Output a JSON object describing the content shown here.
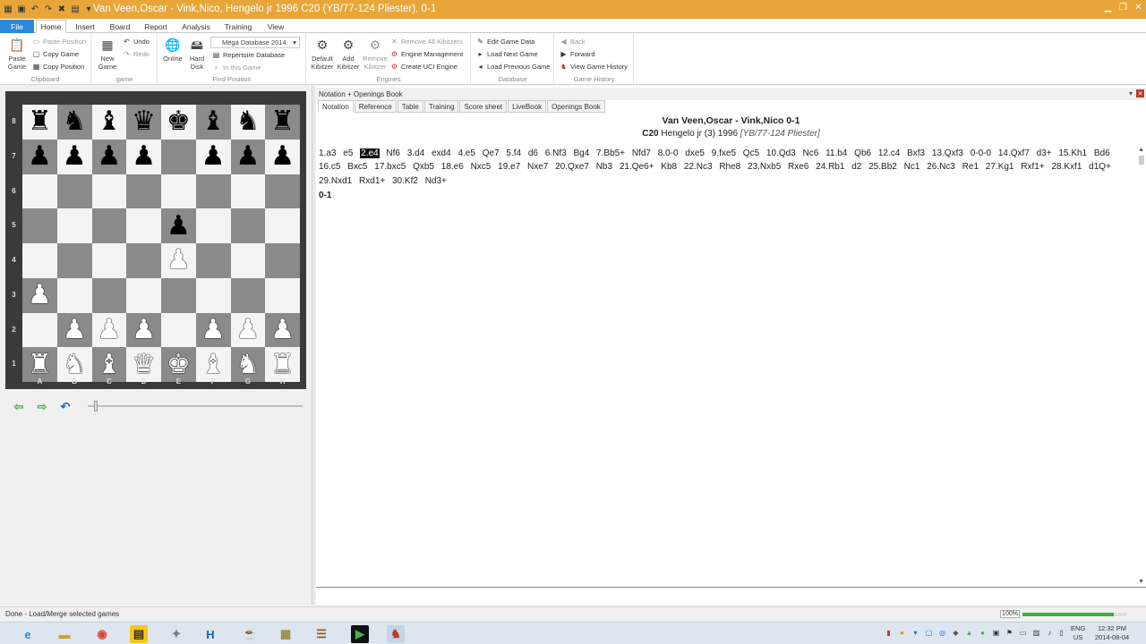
{
  "window": {
    "title": "Van Veen,Oscar - Vink,Nico, Hengelo jr 1996  C20  (YB/77-124 Pliester), 0-1"
  },
  "ribbon_tabs": [
    {
      "label": "File"
    },
    {
      "label": "Home"
    },
    {
      "label": "Insert"
    },
    {
      "label": "Board"
    },
    {
      "label": "Report"
    },
    {
      "label": "Analysis"
    },
    {
      "label": "Training"
    },
    {
      "label": "View"
    }
  ],
  "ribbon": {
    "clipboard": {
      "group": "Clipboard",
      "paste_game_1": "Paste",
      "paste_game_2": "Game",
      "paste_position": "Paste Position",
      "copy_game": "Copy Game",
      "copy_position": "Copy Position"
    },
    "game": {
      "group": "game",
      "new_game_1": "New",
      "new_game_2": "Game",
      "undo": "Undo",
      "redo": "Redo"
    },
    "find_position": {
      "group": "Find Position",
      "online": "Online",
      "hard_disk_1": "Hard",
      "hard_disk_2": "Disk",
      "database_select": "Mega Database 2014",
      "repertoire": "Repertoire Database",
      "in_this_game": "In this Game"
    },
    "engines": {
      "group": "Engines",
      "default_kibitzer_1": "Default",
      "default_kibitzer_2": "Kibitzer",
      "add_kibitzer_1": "Add",
      "add_kibitzer_2": "Kibitzer",
      "remove_kibitzer_1": "Remove",
      "remove_kibitzer_2": "Kibitzer",
      "remove_all": "Remove All Kibitzers",
      "engine_management": "Engine Management",
      "create_uci": "Create UCI Engine"
    },
    "database": {
      "group": "Database",
      "edit_game_data": "Edit Game Data",
      "load_next": "Load Next Game",
      "load_previous": "Load Previous Game"
    },
    "history": {
      "group": "Game History",
      "back": "Back",
      "forward": "Forward",
      "view_history": "View Game History"
    }
  },
  "board": {
    "rank_labels": [
      "8",
      "7",
      "6",
      "5",
      "4",
      "3",
      "2",
      "1"
    ],
    "file_labels": [
      "A",
      "B",
      "C",
      "D",
      "E",
      "F",
      "G",
      "H"
    ],
    "rows": [
      [
        "r",
        "n",
        "b",
        "q",
        "k",
        "b",
        "n",
        "r"
      ],
      [
        "p",
        "p",
        "p",
        "p",
        "",
        "p",
        "p",
        "p"
      ],
      [
        "",
        "",
        "",
        "",
        "",
        "",
        "",
        ""
      ],
      [
        "",
        "",
        "",
        "",
        "p",
        "",
        "",
        ""
      ],
      [
        "",
        "",
        "",
        "",
        "P",
        "",
        "",
        ""
      ],
      [
        "P",
        "",
        "",
        "",
        "",
        "",
        "",
        ""
      ],
      [
        "",
        "P",
        "P",
        "P",
        "",
        "P",
        "P",
        "P"
      ],
      [
        "R",
        "N",
        "B",
        "Q",
        "K",
        "B",
        "N",
        "R"
      ]
    ],
    "light_color": "#f4f4f4",
    "dark_color": "#8a8a8a"
  },
  "notation_panel": {
    "header": "Notation + Openings Book",
    "tabs": [
      "Notation",
      "Reference",
      "Table",
      "Training",
      "Score sheet",
      "LiveBook",
      "Openings Book"
    ],
    "active_tab": "Notation",
    "players": "Van Veen,Oscar - Vink,Nico  0-1",
    "eco": "C20",
    "event": "Hengelo jr (3) 1996",
    "source": "[YB/77-124 Pliester]",
    "moves": [
      "1.a3",
      "e5",
      "2.e4",
      "Nf6",
      "3.d4",
      "exd4",
      "4.e5",
      "Qe7",
      "5.f4",
      "d6",
      "6.Nf3",
      "Bg4",
      "7.Bb5+",
      "Nfd7",
      "8.0-0",
      "dxe5",
      "9.fxe5",
      "Qc5",
      "10.Qd3",
      "Nc6",
      "11.b4",
      "Qb6",
      "12.c4",
      "Bxf3",
      "13.Qxf3",
      "0-0-0",
      "14.Qxf7",
      "d3+",
      "15.Kh1",
      "Bd6",
      "16.c5",
      "Bxc5",
      "17.bxc5",
      "Qxb5",
      "18.e6",
      "Nxc5",
      "19.e7",
      "Nxe7",
      "20.Qxe7",
      "Nb3",
      "21.Qe6+",
      "Kb8",
      "22.Nc3",
      "Rhe8",
      "23.Nxb5",
      "Rxe6",
      "24.Rb1",
      "d2",
      "25.Bb2",
      "Nc1",
      "26.Nc3",
      "Re1",
      "27.Kg1",
      "Rxf1+",
      "28.Kxf1",
      "d1Q+",
      "29.Nxd1",
      "Rxd1+",
      "30.Kf2",
      "Nd3+"
    ],
    "current_move_index": 2,
    "result": "0-1"
  },
  "status": {
    "message": "Done - Load/Merge selected games",
    "zoom": "100%",
    "zoom_fill": 0.88
  },
  "taskbar": {
    "lang_1": "ENG",
    "lang_2": "US",
    "time": "12:32 PM",
    "date": "2014-08-04"
  }
}
